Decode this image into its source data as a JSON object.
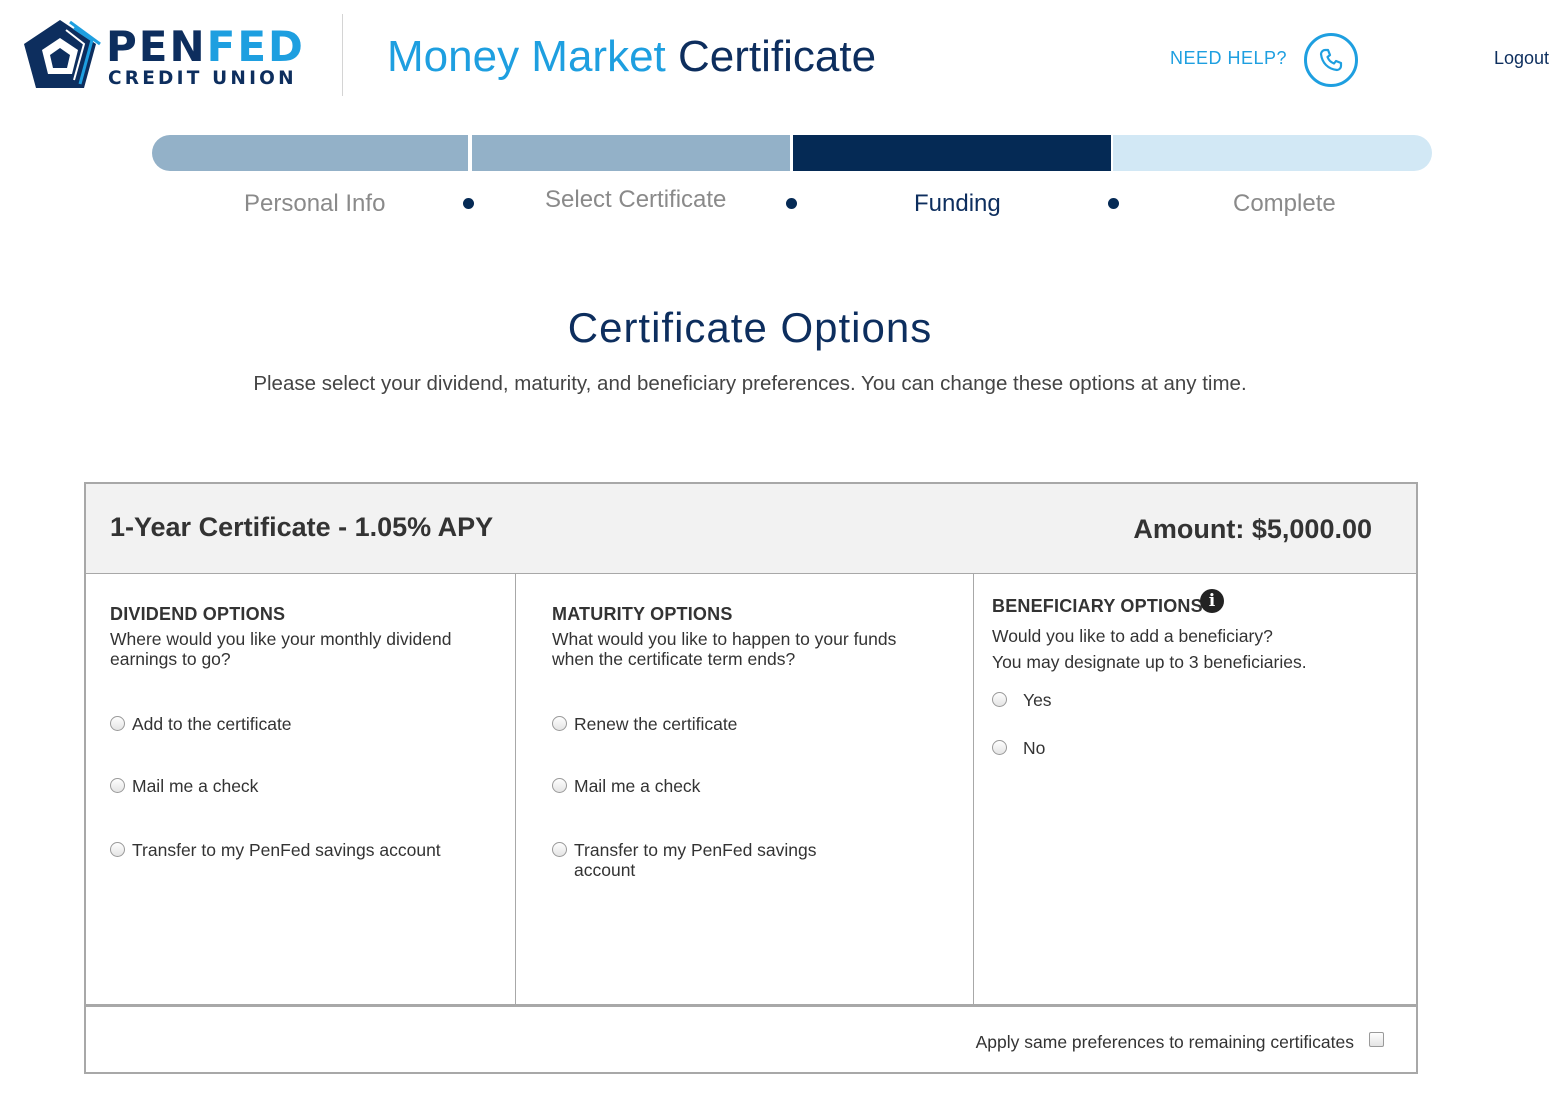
{
  "brand": {
    "name_part1": "PEN",
    "name_part2": "FED",
    "subtitle": "CREDIT UNION",
    "colors": {
      "navy": "#0d2e5e",
      "blue": "#1e9fe0"
    }
  },
  "header": {
    "title_part1": "Money Market",
    "title_part2": "Certificate",
    "need_help": "NEED HELP?",
    "phone_icon": "phone-icon",
    "logout": "Logout"
  },
  "progress": {
    "steps": [
      {
        "label": "Personal Info",
        "state": "done"
      },
      {
        "label": "Select Certificate",
        "state": "done"
      },
      {
        "label": "Funding",
        "state": "current"
      },
      {
        "label": "Complete",
        "state": "upcoming"
      }
    ],
    "colors": {
      "done": "#93b1c8",
      "current": "#052a55",
      "upcoming": "#d2e8f5"
    }
  },
  "page": {
    "title": "Certificate Options",
    "subtitle": "Please select your dividend, maturity, and beneficiary preferences. You can change these options at any time."
  },
  "certificate": {
    "name": "1-Year Certificate - 1.05% APY",
    "amount": "Amount: $5,000.00",
    "dividend": {
      "heading": "DIVIDEND OPTIONS",
      "question_line1": "Where would you like your monthly dividend",
      "question_line2": "earnings to go?",
      "options": [
        "Add to the certificate",
        "Mail me a check",
        "Transfer to my PenFed savings account"
      ]
    },
    "maturity": {
      "heading": "MATURITY OPTIONS",
      "question_line1": "What would you like to happen to your funds",
      "question_line2": "when the certificate term ends?",
      "options": [
        "Renew the certificate",
        "Mail me a check",
        "Transfer to my PenFed savings",
        "account"
      ]
    },
    "beneficiary": {
      "heading": "BENEFICIARY OPTIONS",
      "info_icon": "info-icon",
      "question_line1": "Would you like to add a beneficiary?",
      "question_line2": "You may designate up to 3 beneficiaries.",
      "options": [
        "Yes",
        "No"
      ]
    },
    "apply_same": "Apply same preferences to remaining certificates"
  }
}
